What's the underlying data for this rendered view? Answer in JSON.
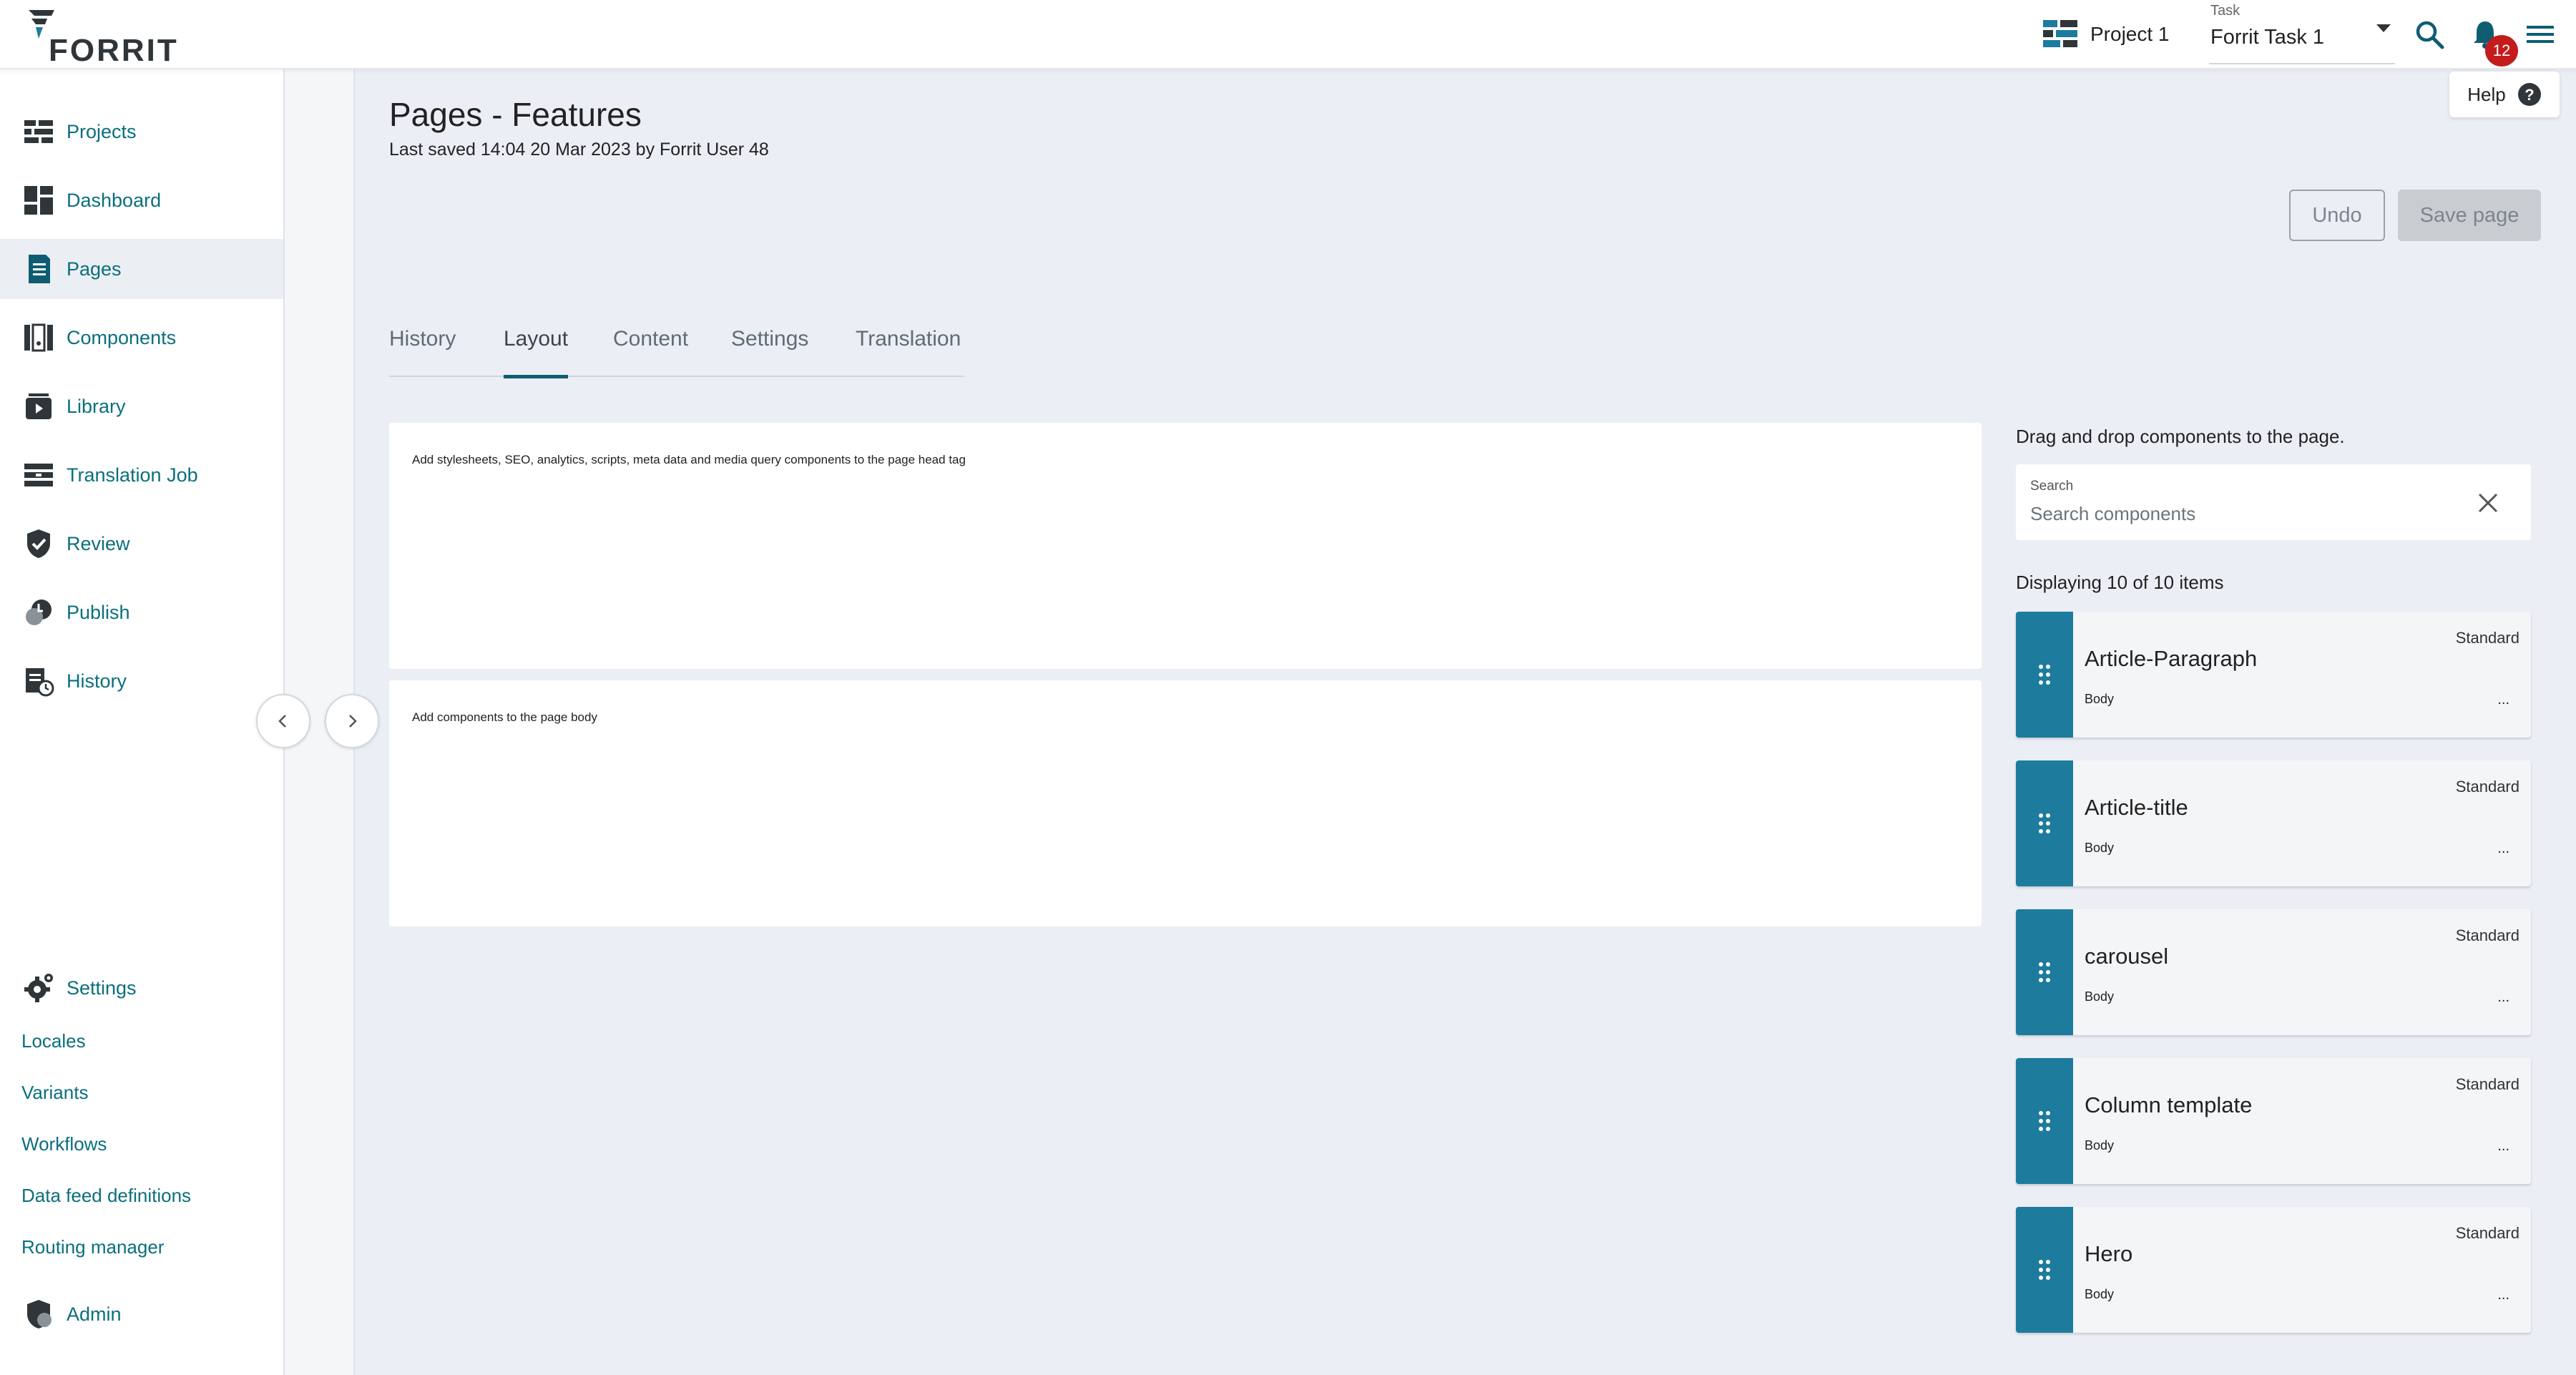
{
  "header": {
    "logo_text": "FORRIT",
    "project_label": "Project 1",
    "task_caption": "Task",
    "task_value": "Forrit Task 1",
    "notification_count": "12",
    "help_label": "Help"
  },
  "sidebar": {
    "items": [
      {
        "label": "Projects",
        "icon": "projects-icon"
      },
      {
        "label": "Dashboard",
        "icon": "dashboard-icon"
      },
      {
        "label": "Pages",
        "icon": "pages-icon",
        "active": true
      },
      {
        "label": "Components",
        "icon": "components-icon"
      },
      {
        "label": "Library",
        "icon": "library-icon"
      },
      {
        "label": "Translation Job",
        "icon": "translation-job-icon"
      },
      {
        "label": "Review",
        "icon": "review-icon"
      },
      {
        "label": "Publish",
        "icon": "publish-icon"
      },
      {
        "label": "History",
        "icon": "history-icon"
      }
    ],
    "settings_label": "Settings",
    "settings_links": [
      "Locales",
      "Variants",
      "Workflows",
      "Data feed definitions",
      "Routing manager"
    ],
    "admin_label": "Admin"
  },
  "page": {
    "title": "Pages - Features",
    "last_saved": "Last saved 14:04 20 Mar 2023 by Forrit User 48",
    "undo_label": "Undo",
    "save_label": "Save page",
    "tabs": [
      "History",
      "Layout",
      "Content",
      "Settings",
      "Translation"
    ],
    "active_tab": "Layout",
    "head_hint": "Add stylesheets, SEO, analytics, scripts, meta data and media query components to the page head tag",
    "body_hint": "Add components to the page body"
  },
  "components_panel": {
    "title": "Drag and drop components to the page.",
    "search_caption": "Search",
    "search_placeholder": "Search components",
    "search_value": "",
    "display_count": "Displaying 10 of 10 items",
    "items": [
      {
        "name": "Article-Paragraph",
        "tag": "Standard",
        "area": "Body",
        "more": "..."
      },
      {
        "name": "Article-title",
        "tag": "Standard",
        "area": "Body",
        "more": "..."
      },
      {
        "name": "carousel",
        "tag": "Standard",
        "area": "Body",
        "more": "..."
      },
      {
        "name": "Column template",
        "tag": "Standard",
        "area": "Body",
        "more": "..."
      },
      {
        "name": "Hero",
        "tag": "Standard",
        "area": "Body",
        "more": "..."
      }
    ]
  },
  "colors": {
    "accent": "#0b6f7d",
    "drag_handle": "#1d7b9e",
    "badge": "#c41c1c",
    "tab_underline": "#0e5d73"
  }
}
